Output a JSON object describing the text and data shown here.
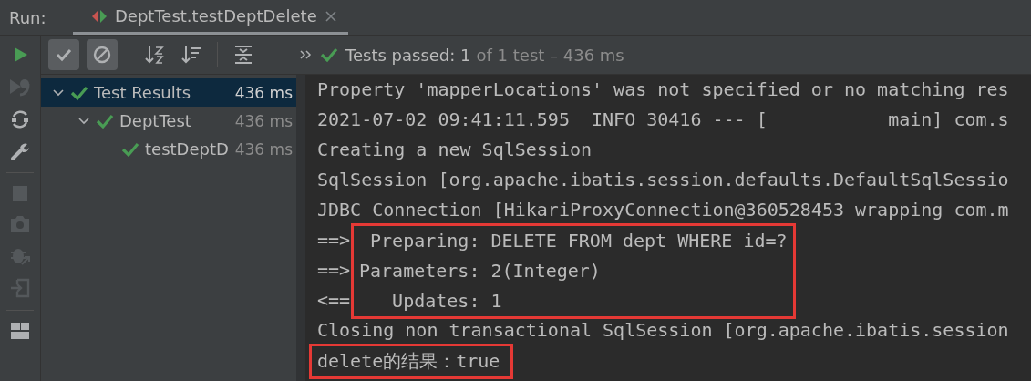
{
  "run_bar": {
    "label": "Run:",
    "tab": {
      "title": "DeptTest.testDeptDelete",
      "selected": true
    }
  },
  "toolbar": {
    "toggles": [
      {
        "kind": "show-passed",
        "on": true
      },
      {
        "kind": "show-ignored",
        "on": true
      }
    ],
    "status": {
      "passed": "Tests passed: 1",
      "rest": "of 1 test – 436 ms"
    }
  },
  "tree": [
    {
      "label": "Test Results",
      "time": "436 ms",
      "kind": "passed",
      "selected": true,
      "expanded": true,
      "children": [
        {
          "label": "DeptTest",
          "time": "436 ms",
          "kind": "passed",
          "selected": false,
          "expanded": true,
          "children": [
            {
              "label": "testDeptD",
              "time": "436 ms",
              "kind": "passed",
              "selected": false
            }
          ]
        }
      ]
    }
  ],
  "console": {
    "blocks": [
      {
        "boxed": false,
        "lines": [
          {
            "text": "Property 'mapperLocations' was not specified or no matching res"
          },
          {
            "text": "2021-07-02 09:41:11.595  INFO 30416 --- [           main] com.s"
          },
          {
            "text": "Creating a new SqlSession"
          },
          {
            "text": "SqlSession [org.apache.ibatis.session.defaults.DefaultSqlSessio"
          },
          {
            "text": "JDBC Connection [HikariProxyConnection@360528453 wrapping com.m"
          }
        ]
      },
      {
        "boxed": true,
        "lines": [
          {
            "prefix": "==>",
            "text": " Preparing: DELETE FROM dept WHERE id=?"
          },
          {
            "prefix": "==>",
            "text": "Parameters: 2(Integer)"
          },
          {
            "prefix": "<==",
            "text": "   Updates: 1"
          }
        ]
      },
      {
        "boxed": false,
        "lines": [
          {
            "text": "Closing non transactional SqlSession [org.apache.ibatis.session"
          }
        ]
      },
      {
        "boxed": true,
        "lines": [
          {
            "text": "delete的结果：true"
          }
        ]
      }
    ]
  }
}
